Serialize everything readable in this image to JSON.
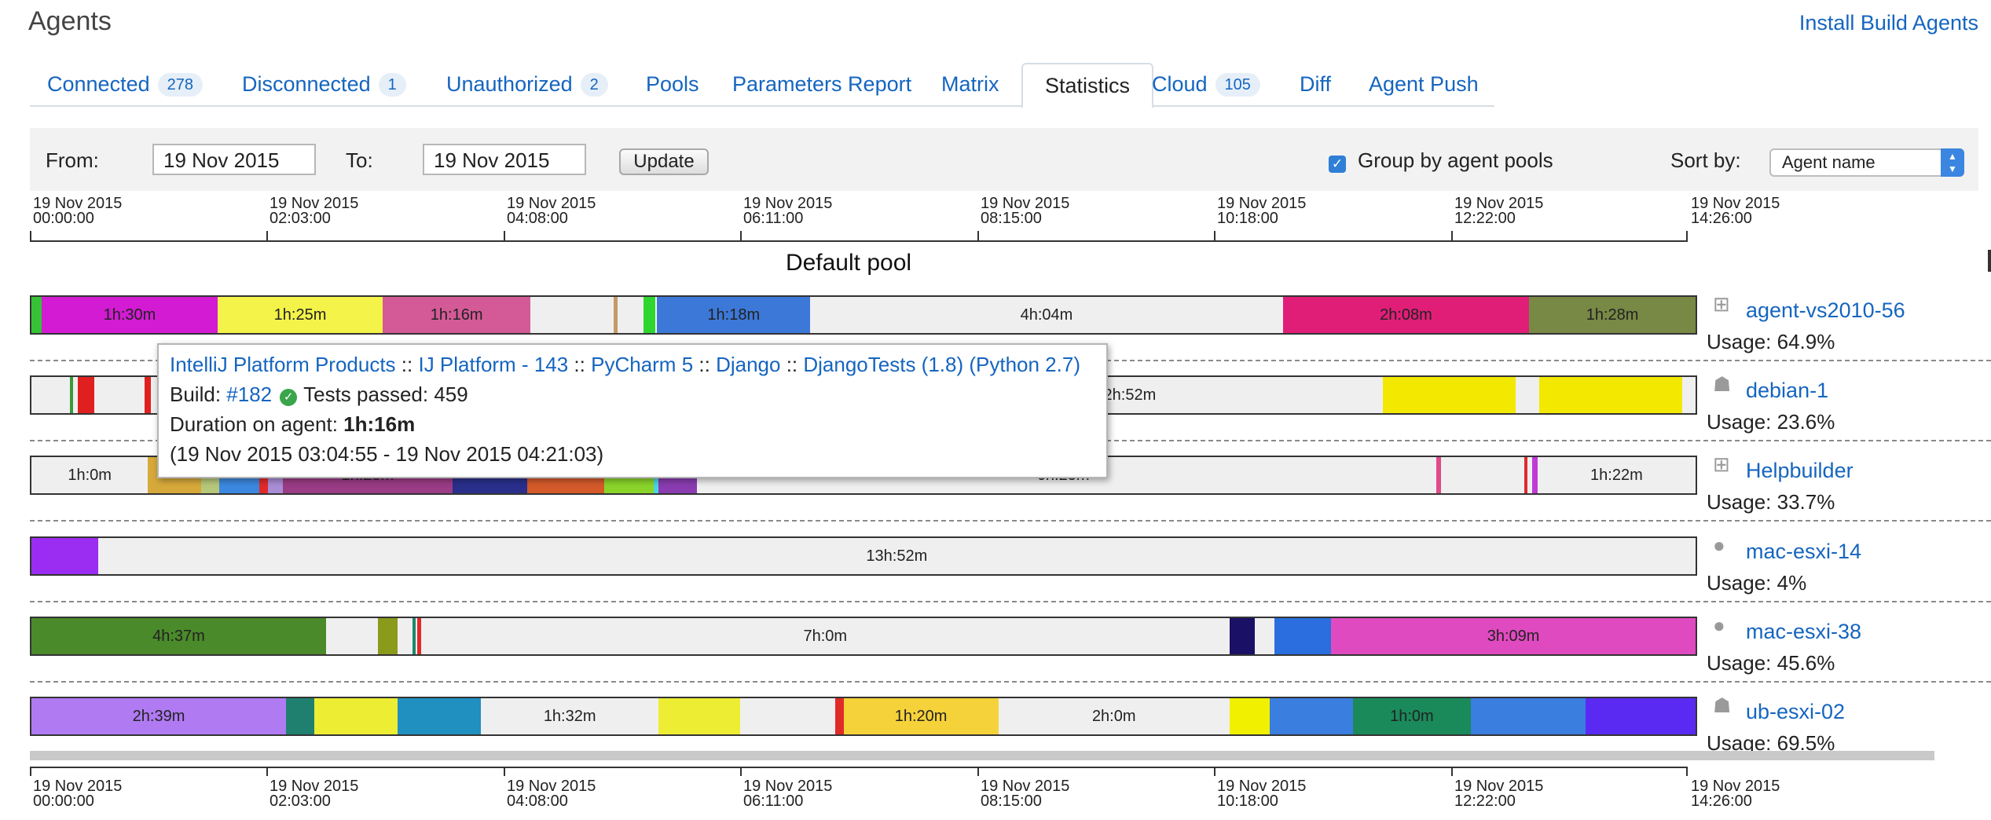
{
  "header": {
    "title": "Agents",
    "install_link": "Install Build Agents"
  },
  "tabs": [
    {
      "label": "Connected",
      "badge": "278"
    },
    {
      "label": "Disconnected",
      "badge": "1"
    },
    {
      "label": "Unauthorized",
      "badge": "2"
    },
    {
      "label": "Pools",
      "badge": ""
    },
    {
      "label": "Parameters Report",
      "badge": ""
    },
    {
      "label": "Matrix",
      "badge": ""
    },
    {
      "label": "Statistics",
      "badge": "",
      "active": true
    },
    {
      "label": "Cloud",
      "badge": "105"
    },
    {
      "label": "Diff",
      "badge": ""
    },
    {
      "label": "Agent Push",
      "badge": ""
    }
  ],
  "filters": {
    "from_label": "From:",
    "from_value": "19 Nov 2015",
    "to_label": "To:",
    "to_value": "19 Nov 2015",
    "update_label": "Update",
    "group_label": "Group by agent pools",
    "group_checked": true,
    "sort_label": "Sort by:",
    "sort_value": "Agent name"
  },
  "timeline": {
    "ticks": [
      {
        "date": "19 Nov 2015",
        "time": "00:00:00"
      },
      {
        "date": "19 Nov 2015",
        "time": "02:03:00"
      },
      {
        "date": "19 Nov 2015",
        "time": "04:08:00"
      },
      {
        "date": "19 Nov 2015",
        "time": "06:11:00"
      },
      {
        "date": "19 Nov 2015",
        "time": "08:15:00"
      },
      {
        "date": "19 Nov 2015",
        "time": "10:18:00"
      },
      {
        "date": "19 Nov 2015",
        "time": "12:22:00"
      },
      {
        "date": "19 Nov 2015",
        "time": "14:26:00"
      }
    ]
  },
  "pool": {
    "name": "Default pool"
  },
  "agents": [
    {
      "name": "agent-vs2010-56",
      "os_icon": "windows-icon",
      "usage": "Usage: 64.9%",
      "segments": [
        {
          "s": 0.0,
          "e": 0.006,
          "c": "#36c236",
          "l": ""
        },
        {
          "s": 0.006,
          "e": 0.112,
          "c": "#d21bd2",
          "l": "1h:30m"
        },
        {
          "s": 0.112,
          "e": 0.211,
          "c": "#f3f34a",
          "l": "1h:25m"
        },
        {
          "s": 0.211,
          "e": 0.3,
          "c": "#d45a97",
          "l": "1h:16m"
        },
        {
          "s": 0.35,
          "e": 0.352,
          "c": "#c59968",
          "l": ""
        },
        {
          "s": 0.368,
          "e": 0.375,
          "c": "#2fd62f",
          "l": ""
        },
        {
          "s": 0.376,
          "e": 0.468,
          "c": "#3c78d8",
          "l": "1h:18m"
        },
        {
          "s": 0.468,
          "e": 0.752,
          "c": "#efefef",
          "l": "4h:04m"
        },
        {
          "s": 0.752,
          "e": 0.9,
          "c": "#e01e78",
          "l": "2h:08m"
        },
        {
          "s": 0.9,
          "e": 1.0,
          "c": "#788845",
          "l": "1h:28m"
        }
      ]
    },
    {
      "name": "debian-1",
      "os_icon": "linux-icon",
      "usage": "Usage: 23.6%",
      "segments": [
        {
          "s": 0.023,
          "e": 0.025,
          "c": "#3a9a3a",
          "l": ""
        },
        {
          "s": 0.028,
          "e": 0.038,
          "c": "#e02020",
          "l": ""
        },
        {
          "s": 0.068,
          "e": 0.072,
          "c": "#e02020",
          "l": ""
        },
        {
          "s": 0.6,
          "e": 0.72,
          "c": "#efefef",
          "l": "2h:52m"
        },
        {
          "s": 0.812,
          "e": 0.892,
          "c": "#f3e900",
          "l": ""
        },
        {
          "s": 0.906,
          "e": 0.992,
          "c": "#f3e900",
          "l": ""
        }
      ]
    },
    {
      "name": "Helpbuilder",
      "os_icon": "windows-icon",
      "usage": "Usage: 33.7%",
      "segments": [
        {
          "s": 0.0,
          "e": 0.07,
          "c": "#efefef",
          "l": "1h:0m"
        },
        {
          "s": 0.07,
          "e": 0.102,
          "c": "#d6a93a",
          "l": ""
        },
        {
          "s": 0.102,
          "e": 0.113,
          "c": "#b8c87a",
          "l": ""
        },
        {
          "s": 0.113,
          "e": 0.137,
          "c": "#3c88e0",
          "l": ""
        },
        {
          "s": 0.137,
          "e": 0.142,
          "c": "#e02a2a",
          "l": ""
        },
        {
          "s": 0.142,
          "e": 0.151,
          "c": "#a98dd6",
          "l": ""
        },
        {
          "s": 0.151,
          "e": 0.253,
          "c": "#9a3c86",
          "l": "1h:25m"
        },
        {
          "s": 0.253,
          "e": 0.298,
          "c": "#2a2f8c",
          "l": ""
        },
        {
          "s": 0.298,
          "e": 0.344,
          "c": "#d45a2a",
          "l": ""
        },
        {
          "s": 0.344,
          "e": 0.374,
          "c": "#8ad42a",
          "l": ""
        },
        {
          "s": 0.374,
          "e": 0.377,
          "c": "#4ad6e0",
          "l": ""
        },
        {
          "s": 0.377,
          "e": 0.4,
          "c": "#8a3cb0",
          "l": ""
        },
        {
          "s": 0.4,
          "e": 0.84,
          "c": "#efefef",
          "l": "6h:25m"
        },
        {
          "s": 0.844,
          "e": 0.847,
          "c": "#e04a8a",
          "l": ""
        },
        {
          "s": 0.897,
          "e": 0.899,
          "c": "#e02a2a",
          "l": ""
        },
        {
          "s": 0.902,
          "e": 0.905,
          "c": "#c03ad6",
          "l": ""
        },
        {
          "s": 0.905,
          "e": 1.0,
          "c": "#efefef",
          "l": "1h:22m"
        }
      ]
    },
    {
      "name": "mac-esxi-14",
      "os_icon": "apple-icon",
      "usage": "Usage: 4%",
      "segments": [
        {
          "s": 0.0,
          "e": 0.04,
          "c": "#9b2cf2",
          "l": ""
        },
        {
          "s": 0.04,
          "e": 1.0,
          "c": "#efefef",
          "l": "13h:52m"
        }
      ]
    },
    {
      "name": "mac-esxi-38",
      "os_icon": "apple-icon",
      "usage": "Usage: 45.6%",
      "segments": [
        {
          "s": 0.0,
          "e": 0.177,
          "c": "#4a8a2a",
          "l": "4h:37m"
        },
        {
          "s": 0.208,
          "e": 0.22,
          "c": "#8a9a1a",
          "l": ""
        },
        {
          "s": 0.229,
          "e": 0.231,
          "c": "#1a8a6a",
          "l": ""
        },
        {
          "s": 0.232,
          "e": 0.234,
          "c": "#e02a2a",
          "l": ""
        },
        {
          "s": 0.234,
          "e": 0.72,
          "c": "#efefef",
          "l": "7h:0m"
        },
        {
          "s": 0.72,
          "e": 0.735,
          "c": "#1a1066",
          "l": ""
        },
        {
          "s": 0.747,
          "e": 0.781,
          "c": "#2a6ee0",
          "l": ""
        },
        {
          "s": 0.781,
          "e": 1.0,
          "c": "#e04ac0",
          "l": "3h:09m"
        }
      ]
    },
    {
      "name": "ub-esxi-02",
      "os_icon": "linux-icon",
      "usage": "Usage: 69.5%",
      "segments": [
        {
          "s": 0.0,
          "e": 0.153,
          "c": "#b07af2",
          "l": "2h:39m"
        },
        {
          "s": 0.153,
          "e": 0.17,
          "c": "#1f8070",
          "l": ""
        },
        {
          "s": 0.17,
          "e": 0.22,
          "c": "#eded34",
          "l": ""
        },
        {
          "s": 0.22,
          "e": 0.27,
          "c": "#1f90c0",
          "l": ""
        },
        {
          "s": 0.27,
          "e": 0.377,
          "c": "#efefef",
          "l": "1h:32m"
        },
        {
          "s": 0.377,
          "e": 0.426,
          "c": "#eded34",
          "l": ""
        },
        {
          "s": 0.483,
          "e": 0.488,
          "c": "#e02a2a",
          "l": ""
        },
        {
          "s": 0.488,
          "e": 0.581,
          "c": "#f6d23a",
          "l": "1h:20m"
        },
        {
          "s": 0.581,
          "e": 0.72,
          "c": "#efefef",
          "l": "2h:0m"
        },
        {
          "s": 0.72,
          "e": 0.744,
          "c": "#f0f000",
          "l": ""
        },
        {
          "s": 0.744,
          "e": 0.794,
          "c": "#3a7ee0",
          "l": ""
        },
        {
          "s": 0.794,
          "e": 0.865,
          "c": "#1a8a5a",
          "l": "1h:0m"
        },
        {
          "s": 0.865,
          "e": 0.934,
          "c": "#3a7ee0",
          "l": ""
        },
        {
          "s": 0.934,
          "e": 1.0,
          "c": "#5a2af2",
          "l": ""
        }
      ]
    }
  ],
  "tooltip": {
    "path": [
      "IntelliJ Platform Products",
      "IJ Platform - 143",
      "PyCharm 5",
      "Django",
      "DjangoTests (1.8) (Python 2.7)"
    ],
    "separator": " :: ",
    "build_label": "Build:",
    "build_number": "#182",
    "tests_status": "Tests passed: 459",
    "duration_label": "Duration on agent:",
    "duration_value": "1h:16m",
    "range": "(19 Nov 2015 03:04:55 - 19 Nov 2015 04:21:03)"
  }
}
